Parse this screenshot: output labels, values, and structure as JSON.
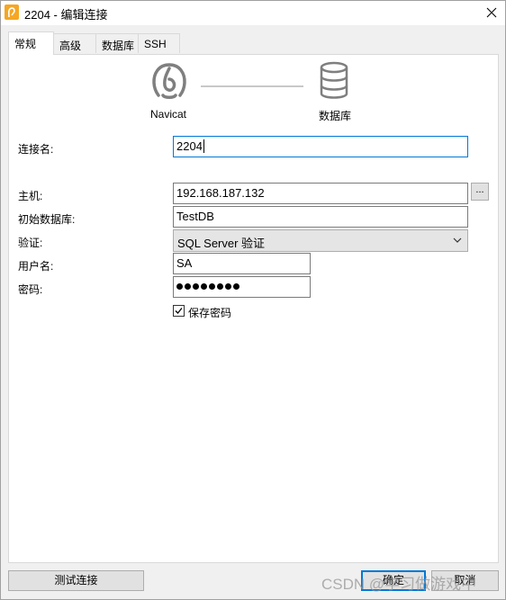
{
  "window": {
    "title": "2204 - 编辑连接",
    "close_symbol": "✕"
  },
  "tabs": [
    {
      "label": "常规",
      "active": true
    },
    {
      "label": "高级",
      "active": false
    },
    {
      "label": "数据库",
      "active": false
    },
    {
      "label": "SSH",
      "active": false
    }
  ],
  "header": {
    "client_label": "Navicat",
    "server_label": "数据库",
    "client_icon": "navicat-logo-icon",
    "server_icon": "database-icon"
  },
  "form": {
    "connection_name": {
      "label": "连接名:",
      "value": "2204"
    },
    "host": {
      "label": "主机:",
      "value": "192.168.187.132",
      "browse_label": "..."
    },
    "initial_database": {
      "label": "初始数据库:",
      "value": "TestDB"
    },
    "authentication": {
      "label": "验证:",
      "value": "SQL Server 验证"
    },
    "username": {
      "label": "用户名:",
      "value": "SA"
    },
    "password": {
      "label": "密码:",
      "masked_length": 8
    },
    "save_password": {
      "label": "保存密码",
      "checked": true
    }
  },
  "buttons": {
    "test_connection": "测试连接",
    "ok": "确定",
    "cancel": "取消"
  },
  "watermark": "CSDN @学习做游戏中",
  "colors": {
    "accent": "#0078d7",
    "app_icon": "#f5a623"
  }
}
